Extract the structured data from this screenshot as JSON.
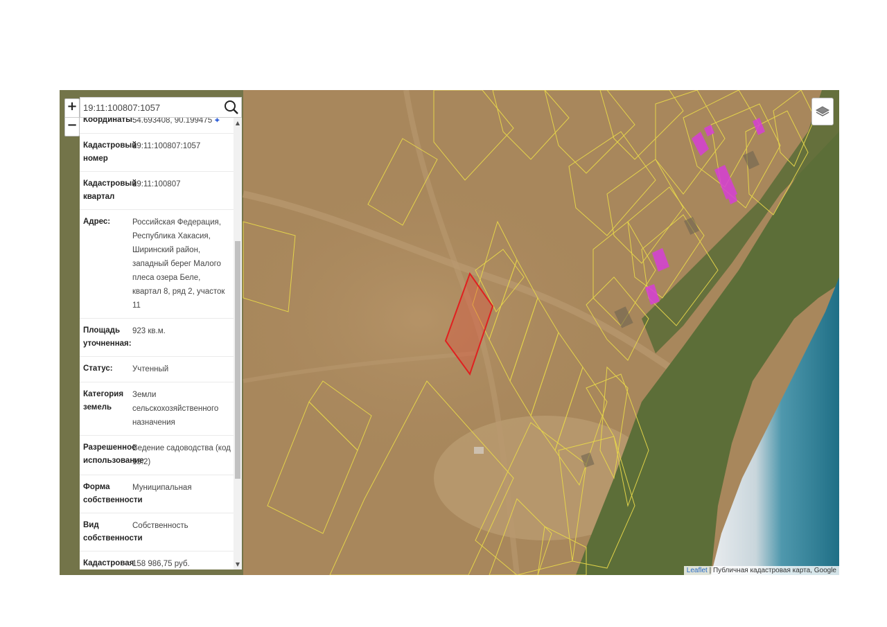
{
  "search": {
    "value": "19:11:100807:1057"
  },
  "zoom": {
    "in": "+",
    "out": "−"
  },
  "info_rows": [
    {
      "key": "Координаты",
      "value": "54.693408, 90.199475"
    },
    {
      "key": "Кадастровый номер",
      "value": "19:11:100807:1057"
    },
    {
      "key": "Кадастровый квартал",
      "value": "19:11:100807"
    },
    {
      "key": "Адрес:",
      "value": "Российская Федерация, Республика Хакасия, Ширинский район, западный берег Малого плеса озера Беле, квартал 8, ряд 2, участок 11"
    },
    {
      "key": "Площадь уточненная:",
      "value": "923 кв.м."
    },
    {
      "key": "Статус:",
      "value": "Учтенный"
    },
    {
      "key": "Категория земель",
      "value": "Земли сельскохозяйственного назначения"
    },
    {
      "key": "Разрешенное использование",
      "value": "Ведение садоводства (код 13.2)"
    },
    {
      "key": "Форма собственности",
      "value": "Муниципальная"
    },
    {
      "key": "Вид собственности",
      "value": "Собственность"
    },
    {
      "key": "Кадастровая стоимость",
      "value": "158 986,75 руб."
    }
  ],
  "attribution": {
    "link": "Leaflet",
    "text": " | Публичная кадастровая карта, Google"
  },
  "icons": {
    "search": "magnifier-icon",
    "layers": "layers-icon",
    "coords": "map-pin-icon"
  },
  "colors": {
    "parcel_outline": "#e8d84a",
    "selected_parcel": "#e02020",
    "building": "#d63fd6",
    "lake": "#2a7d9a",
    "grass": "#5c6e38",
    "soil": "#a8875c"
  }
}
